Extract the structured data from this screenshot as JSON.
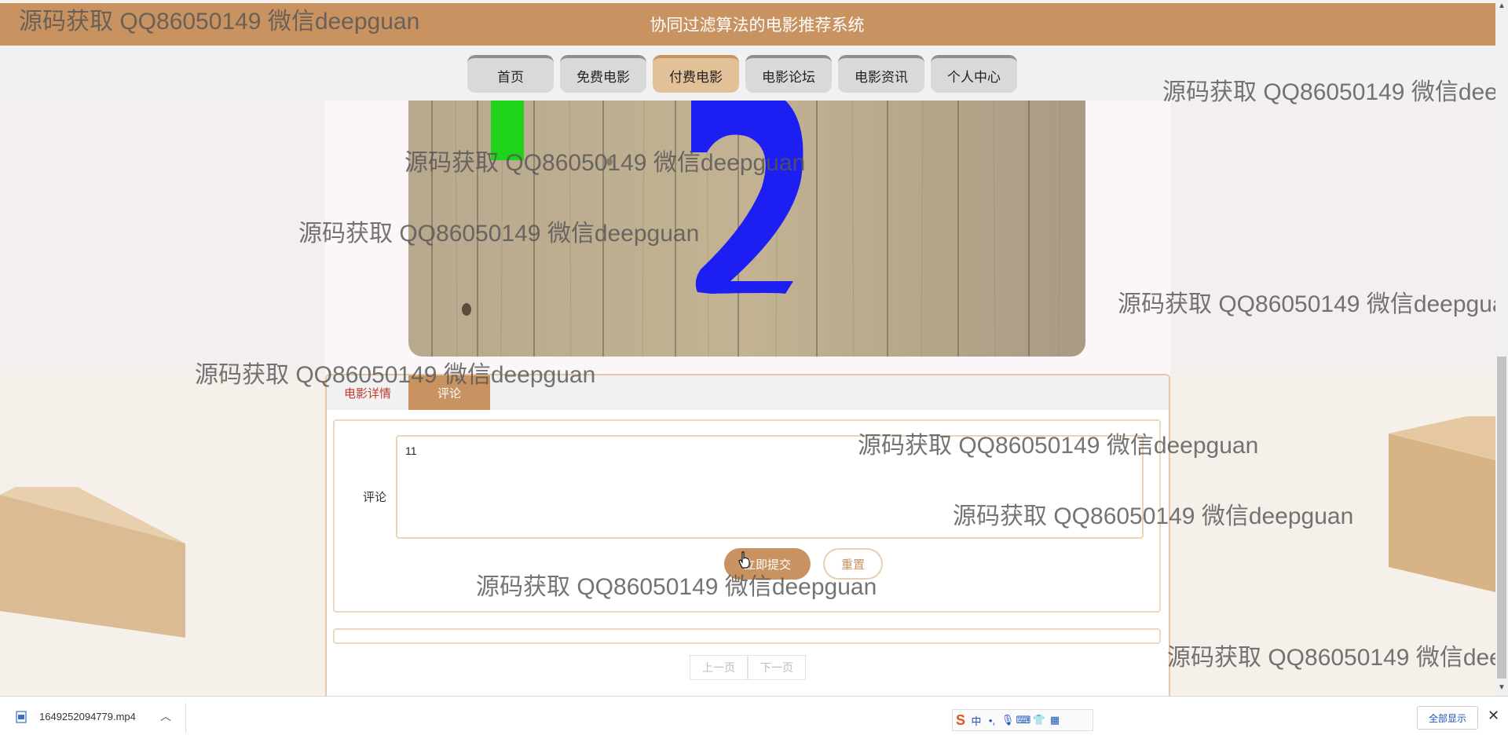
{
  "header": {
    "title": "协同过滤算法的电影推荐系统"
  },
  "nav": {
    "items": [
      {
        "label": "首页"
      },
      {
        "label": "免费电影"
      },
      {
        "label": "付费电影"
      },
      {
        "label": "电影论坛"
      },
      {
        "label": "电影资讯"
      },
      {
        "label": "个人中心"
      }
    ],
    "active_index": 2
  },
  "tabs": {
    "detail": "电影详情",
    "comment": "评论",
    "active": "comment"
  },
  "form": {
    "label": "评论",
    "value": "11",
    "submit": "立即提交",
    "reset": "重置"
  },
  "pager": {
    "prev": "上一页",
    "next": "下一页"
  },
  "watermark": "源码获取 QQ86050149 微信deepguan",
  "download": {
    "file_name": "1649252094779.mp4",
    "show_all": "全部显示"
  },
  "ime": {
    "mode": "中"
  },
  "colors": {
    "accent": "#c89360",
    "tab_active_text": "#c0392b"
  }
}
